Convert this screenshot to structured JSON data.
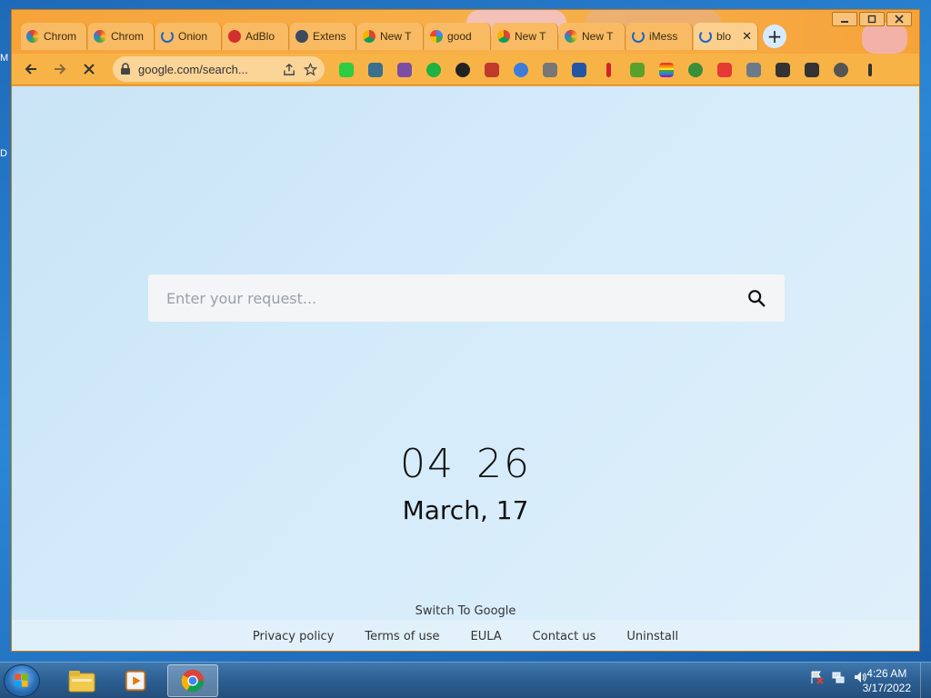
{
  "desktop": {
    "label_top": "M",
    "label_mid": "D"
  },
  "window": {
    "controls": [
      "minimize",
      "maximize",
      "close"
    ]
  },
  "tabs": [
    {
      "label": "Chrom",
      "icon": "rainbow-favicon"
    },
    {
      "label": "Chrom",
      "icon": "rainbow-favicon"
    },
    {
      "label": "Onion",
      "icon": "loading-spinner-icon"
    },
    {
      "label": "AdBlo",
      "icon": "adblock-icon"
    },
    {
      "label": "Extens",
      "icon": "puzzle-icon"
    },
    {
      "label": "New T",
      "icon": "chrome-icon"
    },
    {
      "label": "good",
      "icon": "google-g-icon"
    },
    {
      "label": "New T",
      "icon": "chrome-icon"
    },
    {
      "label": "New T",
      "icon": "rainbow-favicon"
    },
    {
      "label": "iMess",
      "icon": "loading-spinner-icon"
    },
    {
      "label": "blo",
      "icon": "loading-spinner-icon",
      "active": true,
      "close": "✕"
    }
  ],
  "new_tab_label": "+",
  "omnibox": {
    "url": "google.com/search..."
  },
  "extensions": [
    {
      "name": "facetime-icon",
      "color": "#2ecc40"
    },
    {
      "name": "bird-icon",
      "color": "#3a6f8f"
    },
    {
      "name": "alien-icon",
      "color": "#7a4fa3"
    },
    {
      "name": "chat-bubble-icon",
      "color": "#1fb141"
    },
    {
      "name": "pie-icon",
      "color": "#222222"
    },
    {
      "name": "truck-icon",
      "color": "#c0392b"
    },
    {
      "name": "color-wheel-icon",
      "color": "#3b7dd8"
    },
    {
      "name": "square-o-icon",
      "color": "#777777"
    },
    {
      "name": "flag-icon",
      "color": "#2455a4"
    },
    {
      "name": "pencil-icon",
      "color": "#d4212a"
    },
    {
      "name": "leaf-icon",
      "color": "#5aa02c"
    },
    {
      "name": "rainbow-flag-icon",
      "color": "#e53935"
    },
    {
      "name": "globe-icon",
      "color": "#3a8d3a"
    },
    {
      "name": "plus-tile-icon",
      "color": "#e53935"
    },
    {
      "name": "cat-icon",
      "color": "#6b7a89"
    },
    {
      "name": "puzzle-icon",
      "color": "#333333"
    },
    {
      "name": "sidepanel-icon",
      "color": "#333333"
    },
    {
      "name": "profile-icon",
      "color": "#555555"
    },
    {
      "name": "kebab-menu-icon",
      "color": "#333333"
    }
  ],
  "search": {
    "placeholder": "Enter your request..."
  },
  "clock": {
    "hours": "04",
    "minutes": "26"
  },
  "date": "March, 17",
  "switch_link": "Switch To Google",
  "footer_links": [
    "Privacy policy",
    "Terms of use",
    "EULA",
    "Contact us",
    "Uninstall"
  ],
  "taskbar": {
    "items": [
      "explorer-icon",
      "media-player-icon",
      "chrome-icon"
    ],
    "time": "4:26 AM",
    "date": "3/17/2022"
  },
  "colors": {
    "window_theme": "#f7a53a",
    "page_bg": "#d4ebfa",
    "taskbar": "#2c5f92"
  }
}
